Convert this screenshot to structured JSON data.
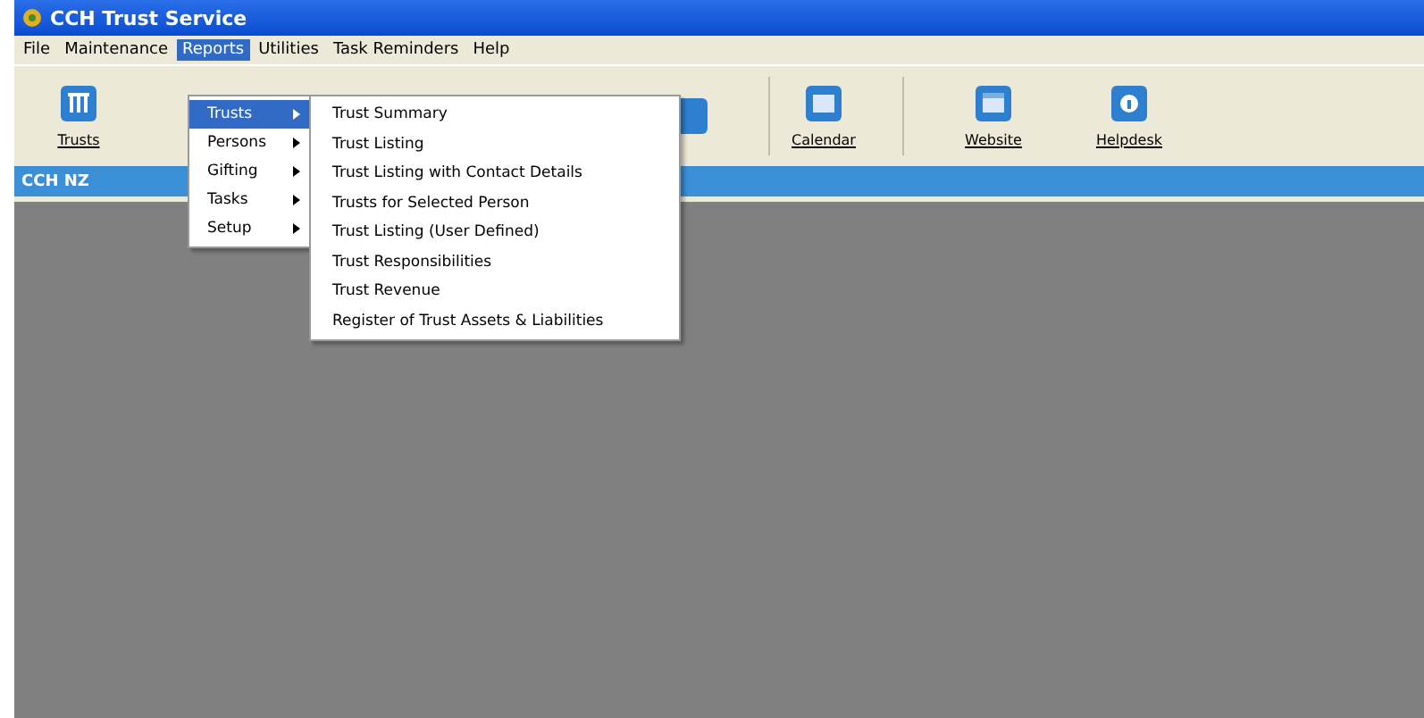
{
  "window": {
    "title": "CCH Trust Service"
  },
  "menubar": [
    {
      "label": "File",
      "selected": false
    },
    {
      "label": "Maintenance",
      "selected": false
    },
    {
      "label": "Reports",
      "selected": true
    },
    {
      "label": "Utilities",
      "selected": false
    },
    {
      "label": "Task Reminders",
      "selected": false
    },
    {
      "label": "Help",
      "selected": false
    }
  ],
  "toolbar": [
    {
      "label": "Trusts"
    },
    {
      "label": "Calendar"
    },
    {
      "label": "Website"
    },
    {
      "label": "Helpdesk"
    }
  ],
  "band": {
    "label": "CCH NZ"
  },
  "reports_menu": [
    {
      "label": "Trusts",
      "selected": true
    },
    {
      "label": "Persons",
      "selected": false
    },
    {
      "label": "Gifting",
      "selected": false
    },
    {
      "label": "Tasks",
      "selected": false
    },
    {
      "label": "Setup",
      "selected": false
    }
  ],
  "submenu": [
    "Trust Summary",
    "Trust Listing",
    "Trust Listing with Contact Details",
    "Trusts for Selected Person",
    "Trust Listing (User Defined)",
    "Trust Responsibilities",
    "Trust Revenue",
    "Register of Trust Assets & Liabilities"
  ]
}
